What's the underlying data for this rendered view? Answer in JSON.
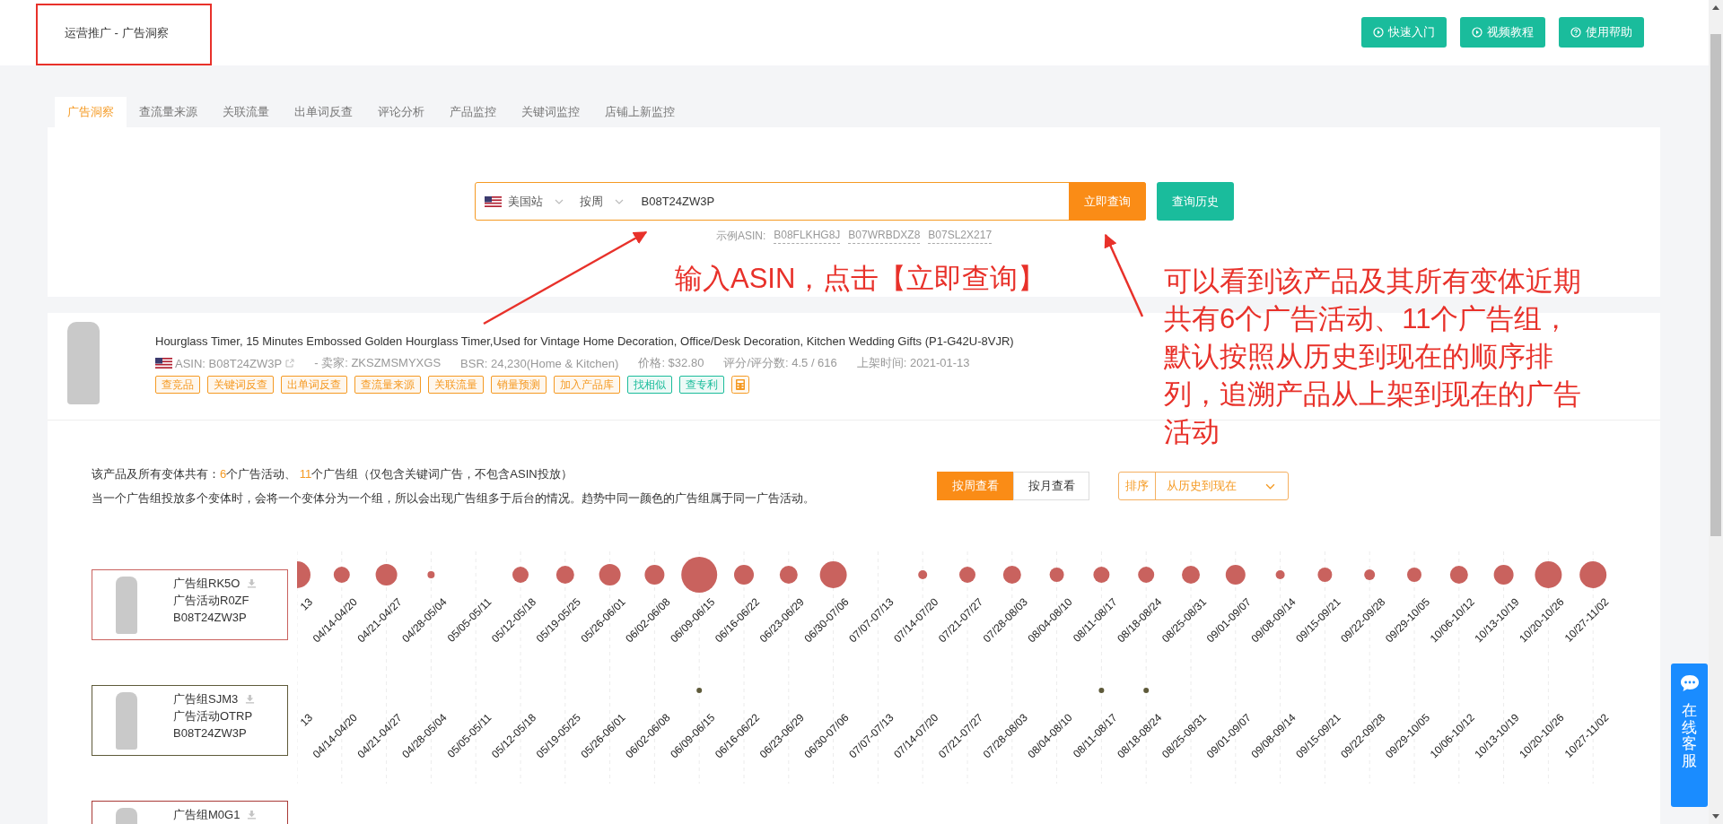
{
  "breadcrumb": "运营推广 - 广告洞察",
  "header_buttons": [
    {
      "label": "快速入门",
      "kind": "play"
    },
    {
      "label": "视频教程",
      "kind": "play"
    },
    {
      "label": "使用帮助",
      "kind": "help"
    }
  ],
  "tabs": [
    {
      "label": "广告洞察",
      "selected": true
    },
    {
      "label": "查流量来源",
      "selected": false
    },
    {
      "label": "关联流量",
      "selected": false
    },
    {
      "label": "出单词反查",
      "selected": false
    },
    {
      "label": "评论分析",
      "selected": false
    },
    {
      "label": "产品监控",
      "selected": false
    },
    {
      "label": "关键词监控",
      "selected": false
    },
    {
      "label": "店铺上新监控",
      "selected": false
    }
  ],
  "search": {
    "site": "美国站",
    "period": "按周",
    "value": "B08T24ZW3P",
    "submit": "立即查询",
    "history": "查询历史",
    "example_label": "示例ASIN:",
    "examples": [
      "B08FLKHG8J",
      "B07WRBDXZ8",
      "B07SL2X217"
    ]
  },
  "annotations": {
    "search_note": "输入ASIN，点击【立即查询】",
    "result_note": "可以看到该产品及其所有变体近期共有6个广告活动、11个广告组，默认按照从历史到现在的顺序排列，追溯产品从上架到现在的广告活动"
  },
  "product": {
    "title": "Hourglass Timer, 15 Minutes Embossed Golden Hourglass Timer,Used for Vintage Home Decoration, Office/Desk Decoration, Kitchen Wedding Gifts (P1-G42U-8VJR)",
    "asin": "ASIN: B08T24ZW3P",
    "seller": "- 卖家: ZKSZMSMYXGS",
    "bsr": "BSR: 24,230(Home & Kitchen)",
    "price": "价格: $32.80",
    "rating": "评分/评分数: 4.5 / 616",
    "listed": "上架时间: 2021-01-13",
    "tags": [
      {
        "label": "查竞品",
        "color": "#f59a23"
      },
      {
        "label": "关键词反查",
        "color": "#f59a23"
      },
      {
        "label": "出单词反查",
        "color": "#f59a23"
      },
      {
        "label": "查流量来源",
        "color": "#f59a23"
      },
      {
        "label": "关联流量",
        "color": "#f59a23"
      },
      {
        "label": "销量预测",
        "color": "#f59a23"
      },
      {
        "label": "加入产品库",
        "color": "#f59a23"
      },
      {
        "label": "找相似",
        "color": "#1bbc9b"
      },
      {
        "label": "查专利",
        "color": "#1bbc9b"
      }
    ]
  },
  "summary": {
    "prefix": "该产品及所有变体共有：",
    "campaigns": "6",
    "campaigns_unit": "个广告活动、 ",
    "groups": "11",
    "suffix": "个广告组（仅包含关键词广告，不包含ASIN投放）",
    "note": "当一个广告组投放多个变体时，会将一个变体分为一个组，所以会出现广告组多于后台的情况。趋势中同一颜色的广告组属于同一广告活动。"
  },
  "view_toggle": [
    {
      "label": "按周查看",
      "selected": true
    },
    {
      "label": "按月查看",
      "selected": false
    }
  ],
  "sort": {
    "label": "排序",
    "value": "从历史到现在"
  },
  "ad_groups": [
    {
      "group": "广告组RK5O",
      "campaign": "广告活动R0ZF",
      "asin": "B08T24ZW3P",
      "color": "#c9625e",
      "weeks": [
        "13",
        "04/14-04/20",
        "04/21-04/27",
        "04/28-05/04",
        "05/05-05/11",
        "05/12-05/18",
        "05/19-05/25",
        "05/26-06/01",
        "06/02-06/08",
        "06/09-06/15",
        "06/16-06/22",
        "06/23-06/29",
        "06/30-07/06",
        "07/07-07/13",
        "07/14-07/20",
        "07/21-07/27",
        "07/28-08/03",
        "08/04-08/10",
        "08/11-08/17",
        "08/18-08/24",
        "08/25-08/31",
        "09/01-09/07",
        "09/08-09/14",
        "09/15-09/21",
        "09/22-09/28",
        "09/29-10/05",
        "10/06-10/12",
        "10/13-10/19",
        "10/20-10/26",
        "10/27-11/02"
      ]
    },
    {
      "group": "广告组SJM3",
      "campaign": "广告活动OTRP",
      "asin": "B08T24ZW3P",
      "color": "#5e5a3a",
      "weeks": [
        "13",
        "04/14-04/20",
        "04/21-04/27",
        "04/28-05/04",
        "05/05-05/11",
        "05/12-05/18",
        "05/19-05/25",
        "05/26-06/01",
        "06/02-06/08",
        "06/09-06/15",
        "06/16-06/22",
        "06/23-06/29",
        "06/30-07/06",
        "07/07-07/13",
        "07/14-07/20",
        "07/21-07/27",
        "07/28-08/03",
        "08/04-08/10",
        "08/11-08/17",
        "08/18-08/24",
        "08/25-08/31",
        "09/01-09/07",
        "09/08-09/14",
        "09/15-09/21",
        "09/22-09/28",
        "09/29-10/05",
        "10/06-10/12",
        "10/13-10/19",
        "10/20-10/26",
        "10/27-11/02"
      ]
    },
    {
      "group": "广告组M0G1",
      "color": "#a93a36"
    }
  ],
  "chat": {
    "label": "在线客服"
  }
}
